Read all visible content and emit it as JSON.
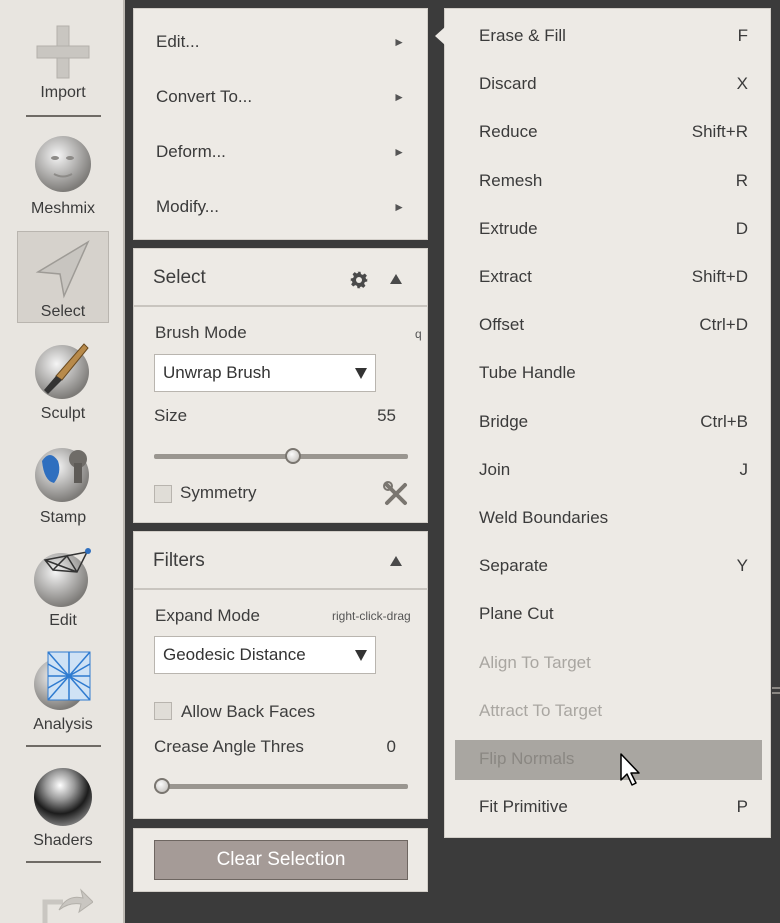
{
  "toolbar": {
    "import": "Import",
    "meshmix": "Meshmix",
    "select": "Select",
    "sculpt": "Sculpt",
    "stamp": "Stamp",
    "edit": "Edit",
    "analysis": "Analysis",
    "shaders": "Shaders"
  },
  "actions_menu": {
    "edit": "Edit...",
    "convert": "Convert To...",
    "deform": "Deform...",
    "modify": "Modify...",
    "arrow": "►"
  },
  "select_panel": {
    "title": "Select",
    "brush_mode_label": "Brush Mode",
    "brush_mode_hint": "q",
    "brush_mode_value": "Unwrap Brush",
    "size_label": "Size",
    "size_value": "55",
    "size_fraction": 0.55,
    "symmetry_label": "Symmetry"
  },
  "filters_panel": {
    "title": "Filters",
    "expand_mode_label": "Expand Mode",
    "expand_mode_hint": "right-click-drag",
    "expand_mode_value": "Geodesic Distance",
    "back_faces_label": "Allow Back Faces",
    "crease_label": "Crease Angle Thres",
    "crease_value": "0",
    "crease_fraction": 0
  },
  "clear_selection": "Clear Selection",
  "submenu": [
    {
      "label": "Erase & Fill",
      "key": "F",
      "disabled": false
    },
    {
      "label": "Discard",
      "key": "X",
      "disabled": false
    },
    {
      "label": "Reduce",
      "key": "Shift+R",
      "disabled": false
    },
    {
      "label": "Remesh",
      "key": "R",
      "disabled": false
    },
    {
      "label": "Extrude",
      "key": "D",
      "disabled": false
    },
    {
      "label": "Extract",
      "key": "Shift+D",
      "disabled": false
    },
    {
      "label": "Offset",
      "key": "Ctrl+D",
      "disabled": false
    },
    {
      "label": "Tube Handle",
      "key": "",
      "disabled": false
    },
    {
      "label": "Bridge",
      "key": "Ctrl+B",
      "disabled": false
    },
    {
      "label": "Join",
      "key": "J",
      "disabled": false
    },
    {
      "label": "Weld Boundaries",
      "key": "",
      "disabled": false
    },
    {
      "label": "Separate",
      "key": "Y",
      "disabled": false
    },
    {
      "label": "Plane Cut",
      "key": "",
      "disabled": false
    },
    {
      "label": "Align To Target",
      "key": "",
      "disabled": true
    },
    {
      "label": "Attract To Target",
      "key": "",
      "disabled": true
    },
    {
      "label": "Flip Normals",
      "key": "",
      "disabled": false,
      "hover": true
    },
    {
      "label": "Fit Primitive",
      "key": "P",
      "disabled": false
    }
  ],
  "colors": {
    "panel_bg": "#edeae5",
    "canvas_bg": "#3b3b3b",
    "button_bg": "#a59b97",
    "hover_bg": "#a9a6a1"
  }
}
